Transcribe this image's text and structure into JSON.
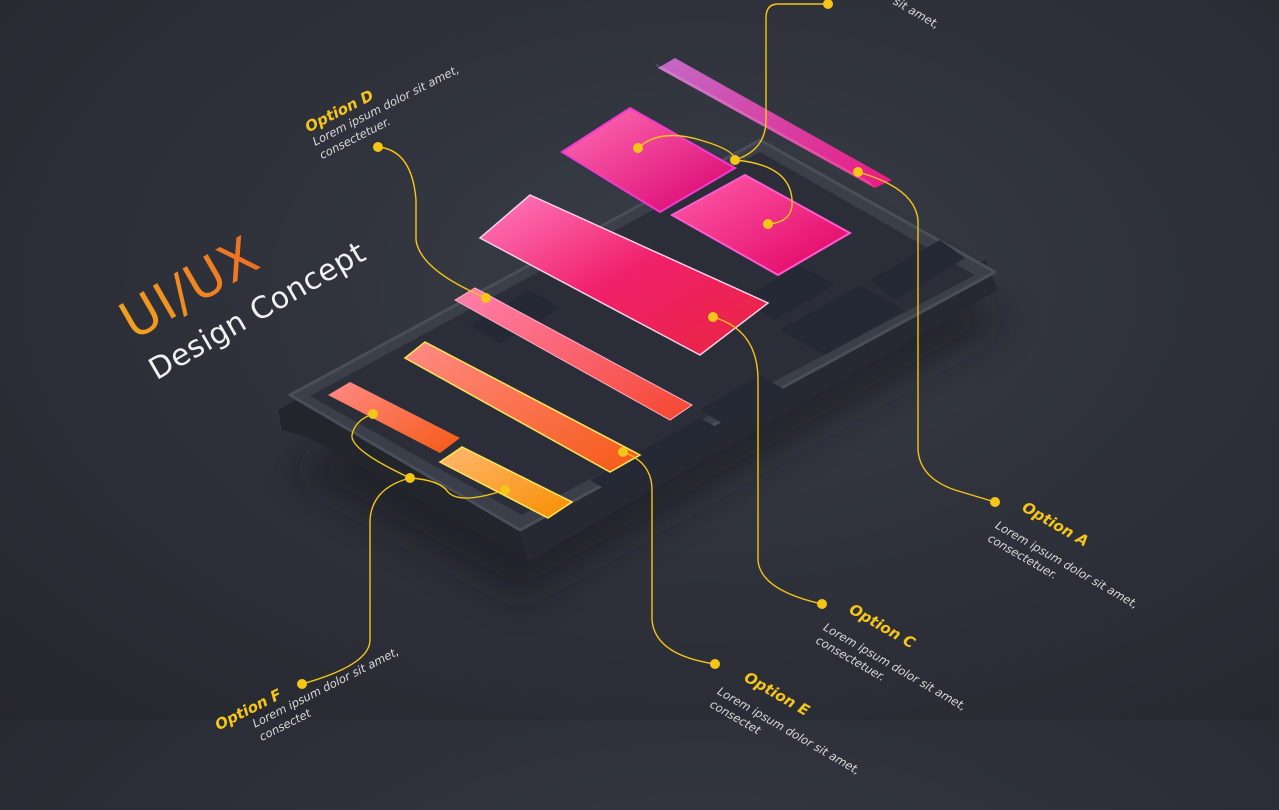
{
  "title": {
    "main": "UI/UX",
    "sub": "Design Concept"
  },
  "options": {
    "a": {
      "name": "Option A",
      "desc1": "Lorem ipsum dolor sit amet,",
      "desc2": "consectetuer."
    },
    "b": {
      "desc": "sit amet,"
    },
    "c": {
      "name": "Option C",
      "desc1": "Lorem ipsum dolor sit amet,",
      "desc2": "consectetuer."
    },
    "d": {
      "name": "Option D",
      "desc1": "Lorem ipsum dolor sit amet,",
      "desc2": "consectetuer."
    },
    "e": {
      "name": "Option E",
      "desc1": "Lorem ipsum dolor sit amet,",
      "desc2": "consectet"
    },
    "f": {
      "name": "Option F",
      "desc1": "Lorem ipsum dolor sit amet,",
      "desc2": "consectet"
    }
  },
  "colors": {
    "background": "#2f323b",
    "accent": "#f5c518",
    "pink": "#e0107a",
    "orange": "#f7941d"
  }
}
